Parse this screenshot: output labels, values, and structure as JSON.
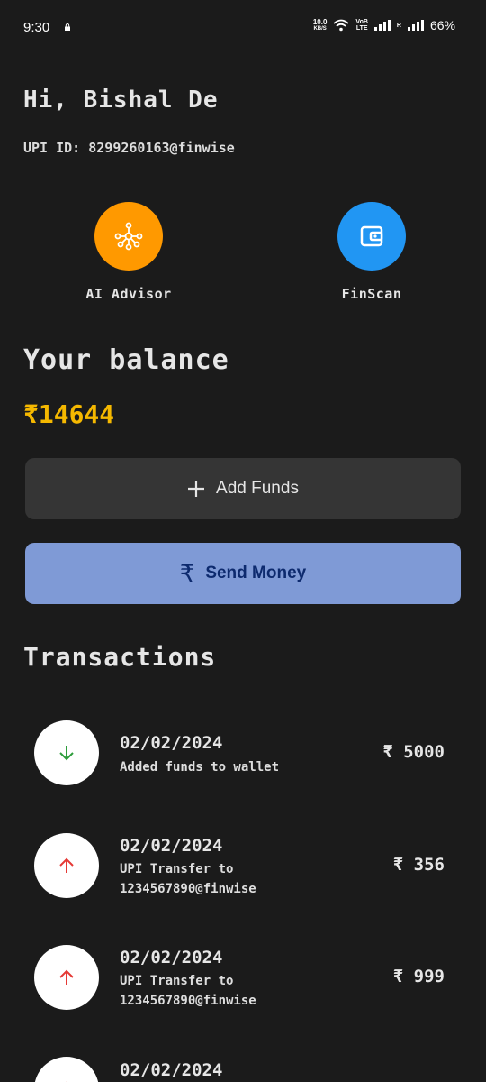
{
  "status_bar": {
    "time": "9:30",
    "speed_value": "10.0",
    "speed_unit": "KB/S",
    "network_top": "VoB",
    "network_bottom": "LTE",
    "roaming": "R",
    "battery": "66%"
  },
  "header": {
    "greeting": "Hi, Bishal De",
    "upi_id": "UPI ID: 8299260163@finwise"
  },
  "quick_actions": [
    {
      "label": "AI Advisor",
      "icon": "hub-icon",
      "color": "#ff9900"
    },
    {
      "label": "FinScan",
      "icon": "wallet-icon",
      "color": "#2196f3"
    }
  ],
  "balance": {
    "title": "Your balance",
    "amount": "₹14644"
  },
  "buttons": {
    "add_funds": "Add Funds",
    "add_icon": "+",
    "send_money": "Send Money",
    "send_icon": "₹"
  },
  "transactions": {
    "title": "Transactions",
    "items": [
      {
        "date": "02/02/2024",
        "desc": "Added funds to wallet",
        "amount": "₹ 5000",
        "direction": "in"
      },
      {
        "date": "02/02/2024",
        "desc": "UPI Transfer to 1234567890@finwise",
        "amount": "₹ 356",
        "direction": "out"
      },
      {
        "date": "02/02/2024",
        "desc": "UPI Transfer to 1234567890@finwise",
        "amount": "₹ 999",
        "direction": "out"
      },
      {
        "date": "02/02/2024",
        "desc": "",
        "amount": "",
        "direction": "out"
      }
    ]
  },
  "colors": {
    "background": "#1b1b1b",
    "balance": "#f5b800",
    "incoming": "#2e9d3c",
    "outgoing": "#e53935"
  }
}
